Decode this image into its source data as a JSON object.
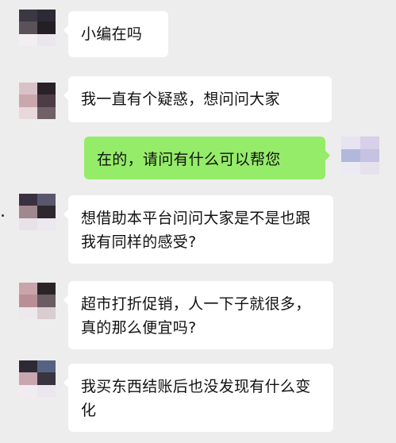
{
  "chat": {
    "messages": [
      {
        "side": "left",
        "text": "小编在吗"
      },
      {
        "side": "left",
        "text": "我一直有个疑惑，想问问大家"
      },
      {
        "side": "right",
        "text": "在的，请问有什么可以帮您"
      },
      {
        "side": "left",
        "text": "想借助本平台问问大家是不是也跟我有同样的感受?"
      },
      {
        "side": "left",
        "text": "超市打折促销，人一下子就很多，真的那么便宜吗?"
      },
      {
        "side": "left",
        "text": "我买东西结账后也没发现有什么变化"
      }
    ]
  },
  "colors": {
    "background": "#ededed",
    "bubble_left": "#ffffff",
    "bubble_right": "#95ec69"
  },
  "avatars": {
    "left_icon": "blurred-avatar-icon",
    "right_icon": "blurred-avatar-icon"
  }
}
